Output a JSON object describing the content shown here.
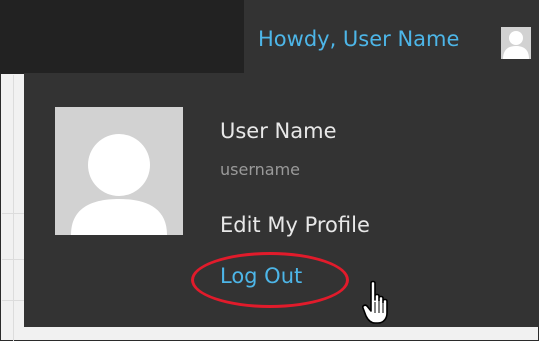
{
  "admin_bar": {
    "greeting": "Howdy, User Name",
    "avatar_icon": "user-avatar-icon"
  },
  "profile_menu": {
    "avatar_icon": "user-avatar-icon",
    "display_name": "User Name",
    "username": "username",
    "edit_profile_label": "Edit My Profile",
    "logout_label": "Log Out"
  },
  "annotation": {
    "highlight_color": "#e11b2b",
    "cursor_icon": "hand-pointer-icon"
  },
  "colors": {
    "link": "#4db6e8",
    "menu_background": "#333333",
    "admin_bar_background": "#222222"
  }
}
